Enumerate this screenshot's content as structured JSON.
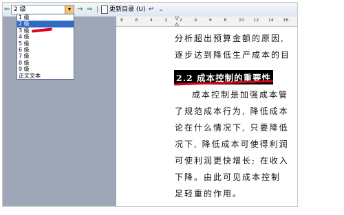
{
  "toolbar": {
    "style_value": "2 级",
    "update_toc_label": "更新目录 (U)"
  },
  "style_dropdown": {
    "items": [
      "1 级",
      "2 级",
      "3 级",
      "4 级",
      "5 级",
      "6 级",
      "7 级",
      "8 级",
      "9 级",
      "正文文本"
    ],
    "selected_index": 1
  },
  "ruler": {
    "ticks": [
      "8",
      "6",
      "4",
      "2",
      "2",
      "4",
      "6",
      "8",
      "10",
      "12",
      "14",
      "16"
    ]
  },
  "document": {
    "lines_before": [
      "分析超出预算金额的原因,",
      "逐步达到降低生产成本的目"
    ],
    "heading": "2.2 成本控制的重要性",
    "body_lines": [
      "成本控制是加强成本管",
      "了规范成本行为, 降低成本",
      "论在什么情况下, 只要降低",
      "况下, 降低成本可使得利润",
      "可使利润更快增长; 在收入",
      "下降。由此可见成本控制",
      "足轻重的作用。"
    ]
  },
  "colors": {
    "highlight_red": "#e0001b",
    "selection_blue": "#316ac5",
    "workspace_grey": "#9ea7b8"
  }
}
